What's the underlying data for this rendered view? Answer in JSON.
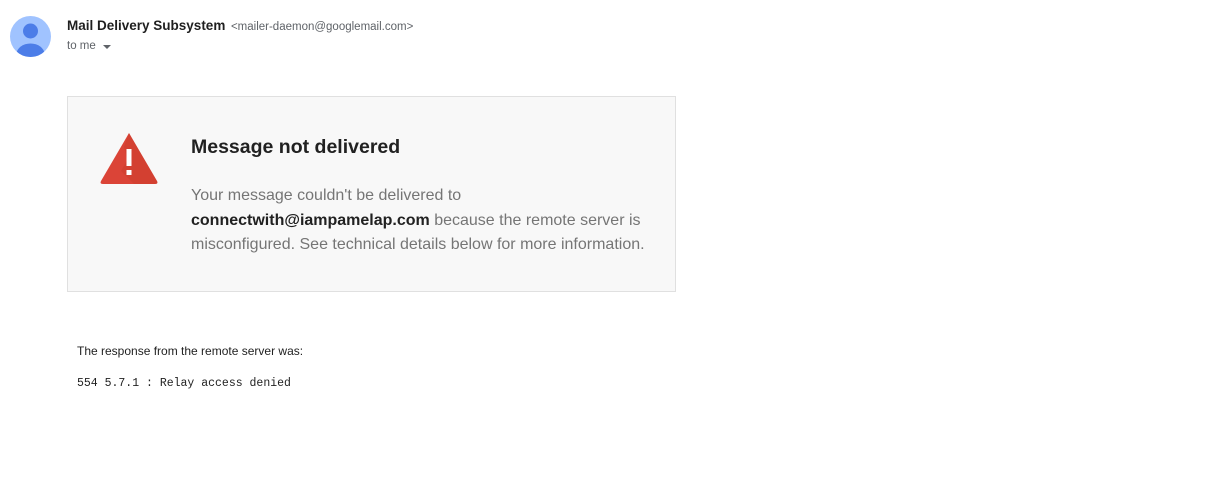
{
  "message": {
    "sender_name": "Mail Delivery Subsystem",
    "sender_email": "<mailer-daemon@googlemail.com>",
    "recipient_label": "to me",
    "recipient_icon": "chevron-down-icon",
    "avatar_icon": "person-icon"
  },
  "notice": {
    "icon": "warning-icon",
    "title": "Message not delivered",
    "text_before": "Your message couldn't be delivered to ",
    "address": "connectwith@iampamelap.com",
    "text_after": " because the remote server is misconfigured. See technical details below for more information."
  },
  "response": {
    "label": "The response from the remote server was:",
    "code": "554 5.7.1 : Relay access denied"
  },
  "colors": {
    "avatar_bg": "#a0c3ff",
    "avatar_figure": "#4c7de8",
    "warning_red": "#db4437",
    "card_bg": "#f8f8f8"
  }
}
